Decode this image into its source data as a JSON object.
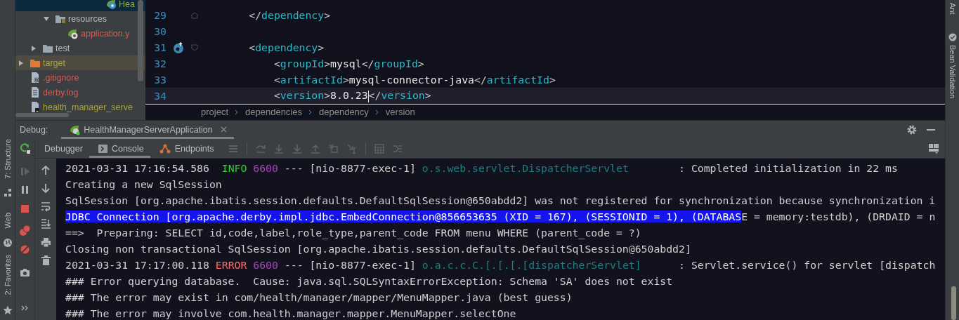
{
  "left_toolbar": {
    "items": [
      {
        "label": "7: Structure",
        "kind": "structure"
      },
      {
        "label": "Web",
        "kind": "web"
      },
      {
        "label": "2: Favorites",
        "kind": "favorites"
      }
    ]
  },
  "project_tree": {
    "items": [
      {
        "children": [
          {
            "children": [
              {
                "children": [
                  {
                    "children": [
                      {
                        "children": [
                          {
                            "children": [
                              {
                                "label": "Hea",
                                "kind": "spring-class",
                                "color": "#9aa83a",
                                "selected": true
                              }
                            ]
                          }
                        ]
                      }
                    ]
                  }
                ]
              },
              {
                "label": "resources",
                "kind": "resources-folder",
                "color": "#bbbbbb",
                "expanded": true,
                "selected": false,
                "children": [
                  {
                    "label": "application.y",
                    "kind": "spring-config",
                    "color": "#d35d4f",
                    "selected": false
                  }
                ]
              }
            ]
          },
          {
            "label": "test",
            "kind": "folder",
            "color": "#bbbbbb",
            "expanded": false,
            "selected": false
          }
        ]
      },
      {
        "label": "target",
        "kind": "excluded-folder",
        "color": "#a9a53c",
        "expanded": false,
        "selected": false
      },
      {
        "label": ".gitignore",
        "kind": "ignore-file",
        "color": "#cf5b56",
        "selected": false
      },
      {
        "label": "derby.log",
        "kind": "text-file",
        "color": "#cf5b56",
        "selected": false
      },
      {
        "label": "health_manager_serve",
        "kind": "script-file",
        "color": "#a9a53c",
        "selected": false
      }
    ]
  },
  "editor": {
    "lines": [
      {
        "number": "29",
        "current": false,
        "fold_start": false,
        "fold_end": true,
        "gutter_icon": false,
        "segments": [
          {
            "kind": "punct",
            "text": "        </"
          },
          {
            "kind": "tag",
            "text": "dependency"
          },
          {
            "kind": "punct",
            "text": ">"
          }
        ]
      },
      {
        "number": "30",
        "current": false,
        "fold_start": false,
        "fold_end": false,
        "gutter_icon": false
      },
      {
        "number": "31",
        "current": false,
        "fold_start": true,
        "fold_end": false,
        "gutter_icon": true,
        "segments": [
          {
            "kind": "punct",
            "text": "        <"
          },
          {
            "kind": "tag",
            "text": "dependency"
          },
          {
            "kind": "punct",
            "text": ">"
          }
        ]
      },
      {
        "number": "32",
        "current": false,
        "fold_start": false,
        "fold_end": false,
        "gutter_icon": false,
        "segments": [
          {
            "kind": "punct",
            "text": "            <"
          },
          {
            "kind": "tag",
            "text": "groupId"
          },
          {
            "kind": "punct",
            "text": ">"
          },
          {
            "kind": "text",
            "text": "mysql"
          },
          {
            "kind": "punct",
            "text": "</"
          },
          {
            "kind": "tag",
            "text": "groupId"
          },
          {
            "kind": "punct",
            "text": ">"
          }
        ]
      },
      {
        "number": "33",
        "current": false,
        "fold_start": false,
        "fold_end": false,
        "gutter_icon": false,
        "segments": [
          {
            "kind": "punct",
            "text": "            <"
          },
          {
            "kind": "tag",
            "text": "artifactId"
          },
          {
            "kind": "punct",
            "text": ">"
          },
          {
            "kind": "text",
            "text": "mysql-connector-java"
          },
          {
            "kind": "punct",
            "text": "</"
          },
          {
            "kind": "tag",
            "text": "artifactId"
          },
          {
            "kind": "punct",
            "text": ">"
          }
        ]
      },
      {
        "number": "34",
        "current": true,
        "fold_start": false,
        "fold_end": false,
        "gutter_icon": false,
        "segments": [
          {
            "kind": "punct",
            "text": "            <"
          },
          {
            "kind": "tag",
            "text": "version"
          },
          {
            "kind": "punct",
            "text": ">"
          },
          {
            "kind": "text",
            "text": "8.0.23",
            "caret": true
          },
          {
            "kind": "punct",
            "text": "</"
          },
          {
            "kind": "tag",
            "text": "version"
          },
          {
            "kind": "punct",
            "text": ">"
          }
        ]
      }
    ],
    "breadcrumbs": [
      "project",
      "dependencies",
      "dependency",
      "version"
    ]
  },
  "right_toolbar": {
    "items": [
      {
        "label": "Ant",
        "kind": "ant"
      },
      {
        "label": "Bean Validation",
        "kind": "bean"
      }
    ]
  },
  "debug": {
    "title": "Debug:",
    "sessions": [
      {
        "label": "HealthManagerServerApplication",
        "selected": true
      }
    ],
    "tabs": [
      {
        "label": "Debugger",
        "kind": "debugger",
        "selected": false
      },
      {
        "label": "Console",
        "kind": "console",
        "selected": true
      },
      {
        "label": "Endpoints",
        "kind": "endpoints",
        "selected": false
      }
    ],
    "console": {
      "lines": [
        {
          "segments": [
            {
              "kind": "plain",
              "text": "2021-03-31 17:16:54.586  "
            },
            {
              "kind": "info",
              "text": "INFO "
            },
            {
              "kind": "pid",
              "text": "6600"
            },
            {
              "kind": "plain",
              "text": " --- [nio-8877-exec-1] "
            },
            {
              "kind": "logger",
              "text": "o.s.web.servlet.DispatcherServlet"
            },
            {
              "kind": "plain",
              "text": "        : Completed initialization in 22 ms"
            }
          ]
        },
        {
          "segments": [
            {
              "kind": "plain",
              "text": "Creating a new SqlSession"
            }
          ]
        },
        {
          "segments": [
            {
              "kind": "plain",
              "text": "SqlSession [org.apache.ibatis.session.defaults.DefaultSqlSession@650abdd2] was not registered for synchronization because synchronization i"
            }
          ]
        },
        {
          "segments": [
            {
              "kind": "selected",
              "text": "JDBC Connection [org.apache.derby.impl.jdbc.EmbedConnection@856653635 (XID = 167), (SESSIONID = 1), (DATABAS"
            },
            {
              "kind": "plain",
              "text": "E = memory:testdb), (DRDAID = n"
            }
          ]
        },
        {
          "segments": [
            {
              "kind": "plain",
              "text": "==>  Preparing: SELECT id,code,label,role_type,parent_code FROM menu WHERE (parent_code = ?)"
            }
          ]
        },
        {
          "segments": [
            {
              "kind": "plain",
              "text": "Closing non transactional SqlSession [org.apache.ibatis.session.defaults.DefaultSqlSession@650abdd2]"
            }
          ]
        },
        {
          "segments": [
            {
              "kind": "plain",
              "text": "2021-03-31 17:17:00.118 "
            },
            {
              "kind": "error",
              "text": "ERROR "
            },
            {
              "kind": "pid",
              "text": "6600"
            },
            {
              "kind": "plain",
              "text": " --- [nio-8877-exec-1] "
            },
            {
              "kind": "logger",
              "text": "o.a.c.c.C.[.[.[.[dispatcherServlet]"
            },
            {
              "kind": "plain",
              "text": "      : Servlet.service() for servlet [dispatch"
            }
          ]
        },
        {
          "segments": [
            {
              "kind": "plain",
              "text": "### Error querying database.  Cause: java.sql.SQLSyntaxErrorException: Schema 'SA' does not exist"
            }
          ]
        },
        {
          "segments": [
            {
              "kind": "plain",
              "text": "### The error may exist in com/health/manager/mapper/MenuMapper.java (best guess)"
            }
          ]
        },
        {
          "segments": [
            {
              "kind": "plain",
              "text": "### The error may involve com.health.manager.mapper.MenuMapper.selectOne"
            }
          ]
        }
      ]
    }
  }
}
